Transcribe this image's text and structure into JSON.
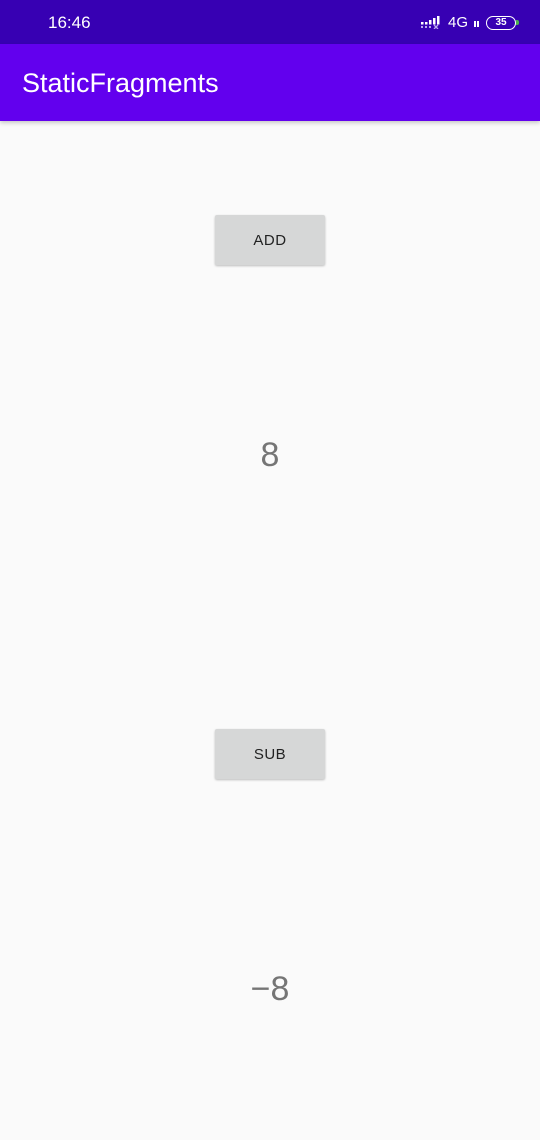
{
  "status_bar": {
    "time": "16:46",
    "network": "4G",
    "battery": "35",
    "icons": [
      "signal-icon",
      "battery-icon"
    ]
  },
  "app_bar": {
    "title": "StaticFragments"
  },
  "fragment_add": {
    "button_label": "ADD",
    "value": "8"
  },
  "fragment_sub": {
    "button_label": "SUB",
    "value": "−8"
  },
  "colors": {
    "status_bar": "#3700b3",
    "app_bar": "#6200ee",
    "background": "#fafafa",
    "button": "#d6d7d7",
    "value_text": "#757575"
  }
}
